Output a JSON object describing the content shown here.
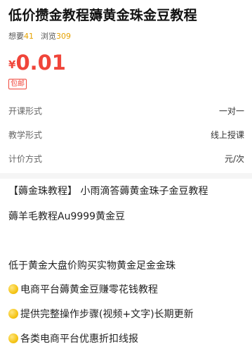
{
  "product": {
    "title": "低价攒金教程薅黄金珠金豆教程",
    "want_label": "想要",
    "want_count": "41",
    "view_label": "浏览",
    "view_count": "309",
    "currency": "¥",
    "price": "0.01",
    "shipping_tag": "包邮"
  },
  "attributes": [
    {
      "label": "开课形式",
      "value": "一对一"
    },
    {
      "label": "教学形式",
      "value": "线上授课"
    },
    {
      "label": "计价方式",
      "value": "元/次"
    }
  ],
  "description": {
    "line1": "【薅金珠教程】 小雨滴答薅黄金珠子金豆教程",
    "line2": "薅羊毛教程Au9999黄金豆",
    "line3": "低于黄金大盘价购买实物黄金足金金珠",
    "bullets": [
      "电商平台薅黄金豆赚零花钱教程",
      "提供完整操作步骤(视频+文字)长期更新",
      "各类电商平台优惠折扣线报"
    ]
  },
  "colors": {
    "price": "#f0453a",
    "count": "#e5a100",
    "bullet": "#f5c518"
  }
}
